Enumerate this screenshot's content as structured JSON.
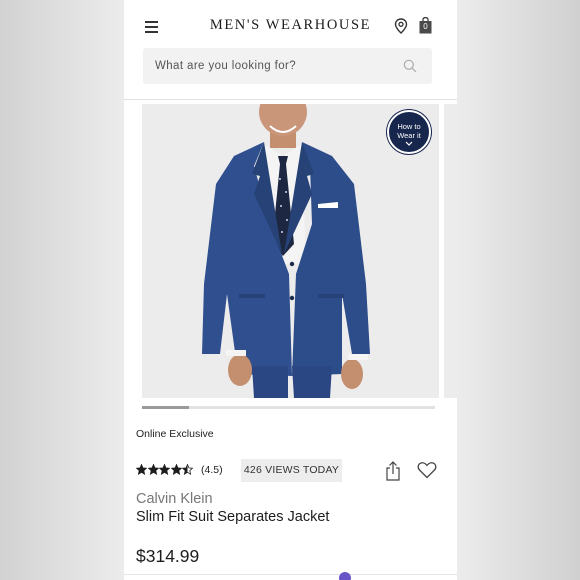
{
  "header": {
    "brand": "MEN'S WEARHOUSE",
    "menu_icon": "hamburger-menu-icon",
    "store_icon": "location-pin-icon",
    "bag_icon": "shopping-bag-icon",
    "bag_count": "0"
  },
  "search": {
    "placeholder": "What are you looking for?",
    "icon": "search-icon"
  },
  "gallery": {
    "how_to_wear_line1": "How to",
    "how_to_wear_line2": "Wear it",
    "scroll_progress": 0.16
  },
  "product": {
    "badge": "Online Exclusive",
    "rating": 4.5,
    "rating_text": "(4.5)",
    "views": "426 VIEWS TODAY",
    "brand": "Calvin Klein",
    "name": "Slim Fit Suit Separates Jacket",
    "price": "$314.99"
  },
  "colors": {
    "suit": "#2f4f8f",
    "button_bg": "#17264d",
    "chat_accent": "#6a55c8"
  }
}
